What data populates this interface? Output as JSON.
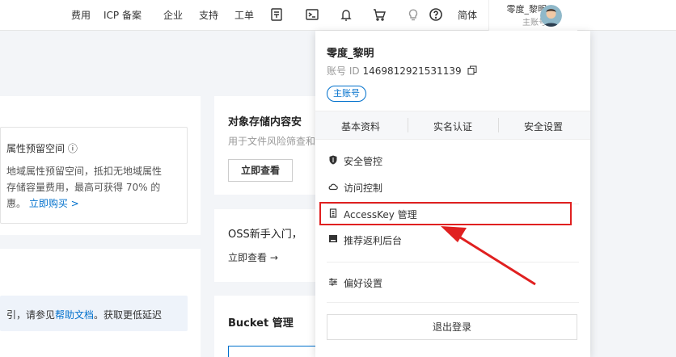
{
  "topnav": {
    "items": [
      "费用",
      "ICP 备案",
      "企业",
      "支持",
      "工单"
    ],
    "lang": "简体",
    "user_name": "零度_黎明",
    "user_role": "主账号"
  },
  "left": {
    "card1_title": "属性预留空间 ⓘ",
    "card1_line1": "地域属性预留空间，抵扣无地域属性",
    "card1_line2": "存储容量费用，最高可获得 70% 的",
    "card1_line3_prefix": "惠。",
    "card1_link": "立即购买 >",
    "help_prefix": "引，请参见",
    "help_link": "帮助文档",
    "help_suffix": "。获取更低延迟"
  },
  "right": {
    "card1_title": "对象存储内容安",
    "card1_desc": "用于文件风险筛查和",
    "card1_button": "立即查看",
    "card2_title": "OSS新手入门，",
    "card2_link": "立即查看 →",
    "card3_title": "Bucket 管理"
  },
  "dropdown": {
    "name": "零度_黎明",
    "id_label": "账号 ID",
    "id_value": "1469812921531139",
    "badge": "主账号",
    "tabs": [
      "基本资料",
      "实名认证",
      "安全设置"
    ],
    "items": [
      {
        "label": "安全管控",
        "icon": "shield-icon"
      },
      {
        "label": "访问控制",
        "icon": "cloud-icon"
      },
      {
        "label": "AccessKey 管理",
        "icon": "key-icon"
      },
      {
        "label": "推荐返利后台",
        "icon": "monitor-icon"
      },
      {
        "label": "偏好设置",
        "icon": "sliders-icon"
      }
    ],
    "logout": "退出登录"
  },
  "colors": {
    "link": "#0070cc",
    "highlight": "#e02020",
    "arrow": "#e02020"
  }
}
